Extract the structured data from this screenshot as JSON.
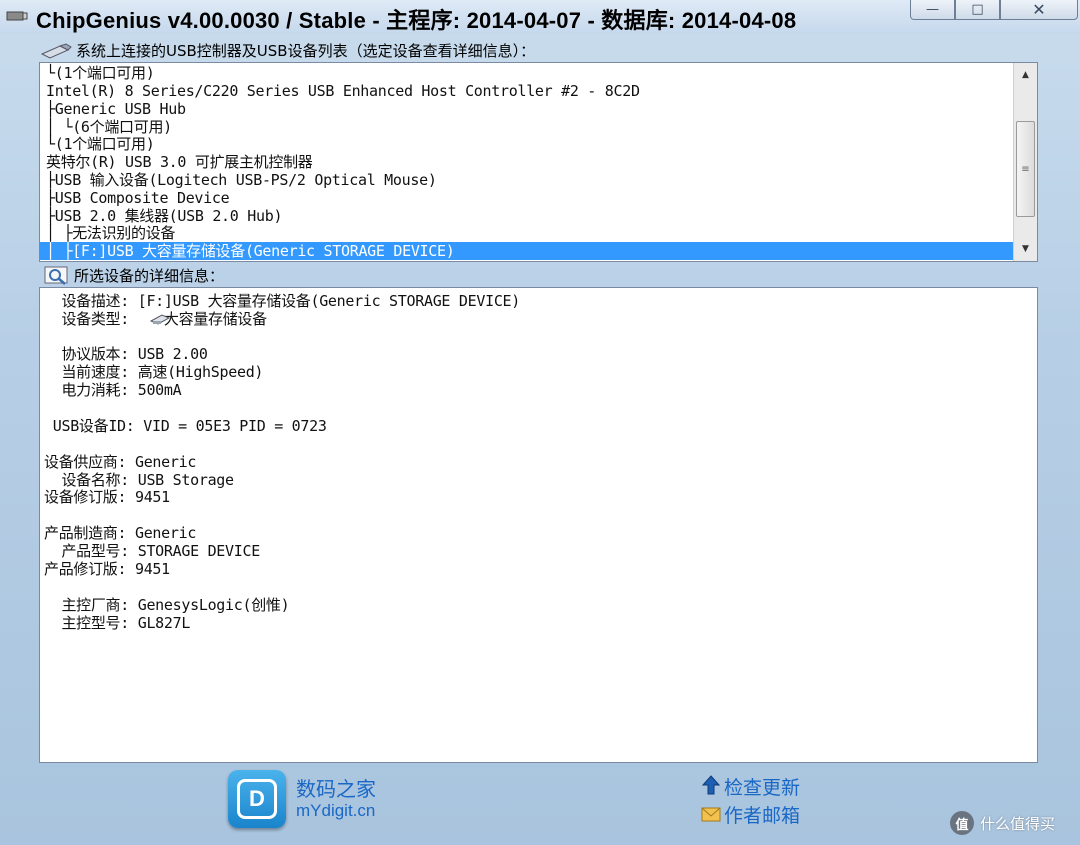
{
  "window": {
    "title": "ChipGenius v4.00.0030 / Stable - 主程序: 2014-04-07 - 数据库: 2014-04-08",
    "controls": {
      "minimize": "—",
      "maximize": "□",
      "close": "✕"
    }
  },
  "device_list": {
    "label": "系统上连接的USB控制器及USB设备列表（选定设备查看详细信息）：",
    "icon": "usb-drive-icon",
    "items": [
      "└(1个端口可用)",
      "Intel(R) 8 Series/C220 Series USB Enhanced Host Controller #2 - 8C2D",
      "├Generic USB Hub",
      "│ └(6个端口可用)",
      "└(1个端口可用)",
      "英特尔(R) USB 3.0 可扩展主机控制器",
      "├USB 输入设备(Logitech USB-PS/2 Optical Mouse)",
      "├USB Composite Device",
      "├USB 2.0 集线器(USB 2.0 Hub)",
      "│ ├无法识别的设备",
      "│ ├[F:]USB 大容量存储设备(Generic STORAGE DEVICE)"
    ],
    "selected_index": 10
  },
  "details": {
    "label": "所选设备的详细信息：",
    "icon": "magnifier-icon",
    "lines": [
      "  设备描述: [F:]USB 大容量存储设备(Generic STORAGE DEVICE)",
      "  设备类型:    大容量存储设备",
      "",
      "  协议版本: USB 2.00",
      "  当前速度: 高速(HighSpeed)",
      "  电力消耗: 500mA",
      "",
      " USB设备ID: VID = 05E3 PID = 0723",
      "",
      "设备供应商: Generic",
      "  设备名称: USB Storage",
      "设备修订版: 9451",
      "",
      "产品制造商: Generic",
      "  产品型号: STORAGE DEVICE",
      "产品修订版: 9451",
      "",
      "  主控厂商: GenesysLogic(创惟)",
      "  主控型号: GL827L"
    ]
  },
  "footer": {
    "brand_name": "数码之家",
    "brand_url": "mYdigit.cn",
    "check_update": "检查更新",
    "author_email": "作者邮箱"
  },
  "watermark": {
    "badge": "值",
    "text": "什么值得买"
  },
  "colors": {
    "selection": "#3399ff",
    "link": "#1a68c6"
  }
}
